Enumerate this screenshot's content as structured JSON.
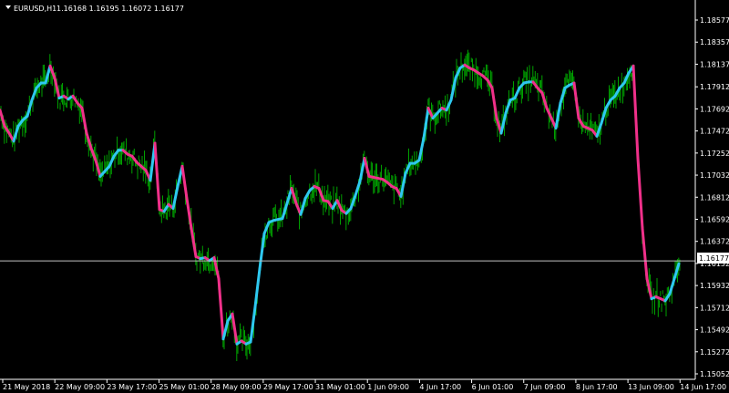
{
  "header": {
    "symbol": "EURUSD,H1",
    "ohlc": "1.16168 1.16195 1.16072 1.16177",
    "dropdown_icon": "triangle-down-icon"
  },
  "colors": {
    "background": "#000000",
    "bars": "#00a000",
    "ma_up": "#2ec8f0",
    "ma_down": "#f0308a",
    "price_line": "#bfbfbf",
    "price_label_bg": "#ffffff",
    "price_label_text": "#000000",
    "axis": "#ffffff"
  },
  "chart_data": {
    "type": "line",
    "title": "EURUSD,H1",
    "ylim": [
      1.15052,
      1.18577
    ],
    "y_ticks": [
      "1.18577",
      "1.18357",
      "1.18137",
      "1.17912",
      "1.17692",
      "1.17472",
      "1.17252",
      "1.17032",
      "1.16812",
      "1.16592",
      "1.16372",
      "1.16152",
      "1.15932",
      "1.15712",
      "1.15492",
      "1.15272",
      "1.15052"
    ],
    "x_ticks": [
      "21 May 2018",
      "22 May 09:00",
      "23 May 17:00",
      "25 May 01:00",
      "28 May 09:00",
      "29 May 17:00",
      "31 May 01:00",
      "1 Jun 09:00",
      "4 Jun 17:00",
      "6 Jun 01:00",
      "7 Jun 09:00",
      "8 Jun 17:00",
      "13 Jun 09:00",
      "14 Jun 17:00"
    ],
    "current_price": 1.16177,
    "current_price_label": "1.16177",
    "ma": [
      [
        0,
        1.1768
      ],
      [
        5,
        1.1752
      ],
      [
        10,
        1.1745
      ],
      [
        15,
        1.1737
      ],
      [
        20,
        1.1752
      ],
      [
        25,
        1.1758
      ],
      [
        30,
        1.1762
      ],
      [
        35,
        1.1778
      ],
      [
        40,
        1.179
      ],
      [
        45,
        1.1795
      ],
      [
        50,
        1.1795
      ],
      [
        55,
        1.1812
      ],
      [
        60,
        1.18
      ],
      [
        65,
        1.178
      ],
      [
        70,
        1.1782
      ],
      [
        75,
        1.1779
      ],
      [
        80,
        1.1782
      ],
      [
        85,
        1.1775
      ],
      [
        90,
        1.177
      ],
      [
        95,
        1.1745
      ],
      [
        100,
        1.173
      ],
      [
        105,
        1.1718
      ],
      [
        110,
        1.1702
      ],
      [
        115,
        1.1707
      ],
      [
        120,
        1.1712
      ],
      [
        125,
        1.1722
      ],
      [
        130,
        1.1728
      ],
      [
        135,
        1.1728
      ],
      [
        140,
        1.1724
      ],
      [
        145,
        1.1722
      ],
      [
        150,
        1.1716
      ],
      [
        155,
        1.1712
      ],
      [
        160,
        1.1708
      ],
      [
        165,
        1.1698
      ],
      [
        170,
        1.1735
      ],
      [
        175,
        1.1669
      ],
      [
        180,
        1.1667
      ],
      [
        185,
        1.1674
      ],
      [
        190,
        1.167
      ],
      [
        195,
        1.1692
      ],
      [
        200,
        1.1712
      ],
      [
        205,
        1.168
      ],
      [
        210,
        1.165
      ],
      [
        215,
        1.1622
      ],
      [
        220,
        1.162
      ],
      [
        225,
        1.1621
      ],
      [
        230,
        1.1618
      ],
      [
        235,
        1.1621
      ],
      [
        240,
        1.16
      ],
      [
        245,
        1.154
      ],
      [
        250,
        1.1558
      ],
      [
        255,
        1.1565
      ],
      [
        260,
        1.1535
      ],
      [
        265,
        1.1538
      ],
      [
        270,
        1.1535
      ],
      [
        275,
        1.1537
      ],
      [
        280,
        1.1572
      ],
      [
        285,
        1.161
      ],
      [
        290,
        1.1645
      ],
      [
        295,
        1.1656
      ],
      [
        300,
        1.1658
      ],
      [
        305,
        1.1659
      ],
      [
        310,
        1.166
      ],
      [
        315,
        1.1675
      ],
      [
        320,
        1.169
      ],
      [
        325,
        1.1675
      ],
      [
        330,
        1.1664
      ],
      [
        335,
        1.168
      ],
      [
        340,
        1.1688
      ],
      [
        345,
        1.1692
      ],
      [
        350,
        1.169
      ],
      [
        355,
        1.1678
      ],
      [
        360,
        1.1677
      ],
      [
        365,
        1.167
      ],
      [
        370,
        1.1678
      ],
      [
        375,
        1.1668
      ],
      [
        380,
        1.1665
      ],
      [
        385,
        1.167
      ],
      [
        390,
        1.1683
      ],
      [
        395,
        1.1697
      ],
      [
        400,
        1.172
      ],
      [
        405,
        1.1702
      ],
      [
        410,
        1.1701
      ],
      [
        415,
        1.17
      ],
      [
        420,
        1.1699
      ],
      [
        425,
        1.1696
      ],
      [
        430,
        1.1692
      ],
      [
        435,
        1.169
      ],
      [
        440,
        1.1682
      ],
      [
        445,
        1.1705
      ],
      [
        450,
        1.1715
      ],
      [
        455,
        1.1715
      ],
      [
        460,
        1.1718
      ],
      [
        465,
        1.174
      ],
      [
        470,
        1.177
      ],
      [
        475,
        1.176
      ],
      [
        480,
        1.1765
      ],
      [
        485,
        1.177
      ],
      [
        490,
        1.1768
      ],
      [
        495,
        1.1778
      ],
      [
        500,
        1.18
      ],
      [
        505,
        1.181
      ],
      [
        510,
        1.1813
      ],
      [
        515,
        1.181
      ],
      [
        520,
        1.1808
      ],
      [
        525,
        1.1805
      ],
      [
        530,
        1.1802
      ],
      [
        535,
        1.1798
      ],
      [
        540,
        1.179
      ],
      [
        545,
        1.176
      ],
      [
        550,
        1.1745
      ],
      [
        555,
        1.1765
      ],
      [
        560,
        1.1778
      ],
      [
        565,
        1.178
      ],
      [
        570,
        1.179
      ],
      [
        575,
        1.1795
      ],
      [
        580,
        1.1796
      ],
      [
        585,
        1.1796
      ],
      [
        590,
        1.179
      ],
      [
        595,
        1.1785
      ],
      [
        600,
        1.177
      ],
      [
        605,
        1.176
      ],
      [
        610,
        1.175
      ],
      [
        615,
        1.1775
      ],
      [
        620,
        1.179
      ],
      [
        625,
        1.1793
      ],
      [
        630,
        1.1795
      ],
      [
        635,
        1.176
      ],
      [
        640,
        1.1752
      ],
      [
        645,
        1.175
      ],
      [
        650,
        1.1748
      ],
      [
        655,
        1.1742
      ],
      [
        660,
        1.1755
      ],
      [
        665,
        1.177
      ],
      [
        670,
        1.1778
      ],
      [
        675,
        1.1782
      ],
      [
        680,
        1.179
      ],
      [
        685,
        1.1795
      ],
      [
        690,
        1.1805
      ],
      [
        695,
        1.1812
      ],
      [
        700,
        1.172
      ],
      [
        705,
        1.165
      ],
      [
        710,
        1.16
      ],
      [
        715,
        1.158
      ],
      [
        720,
        1.1582
      ],
      [
        725,
        1.158
      ],
      [
        730,
        1.1578
      ],
      [
        735,
        1.1585
      ],
      [
        740,
        1.16
      ],
      [
        745,
        1.1615
      ]
    ]
  }
}
